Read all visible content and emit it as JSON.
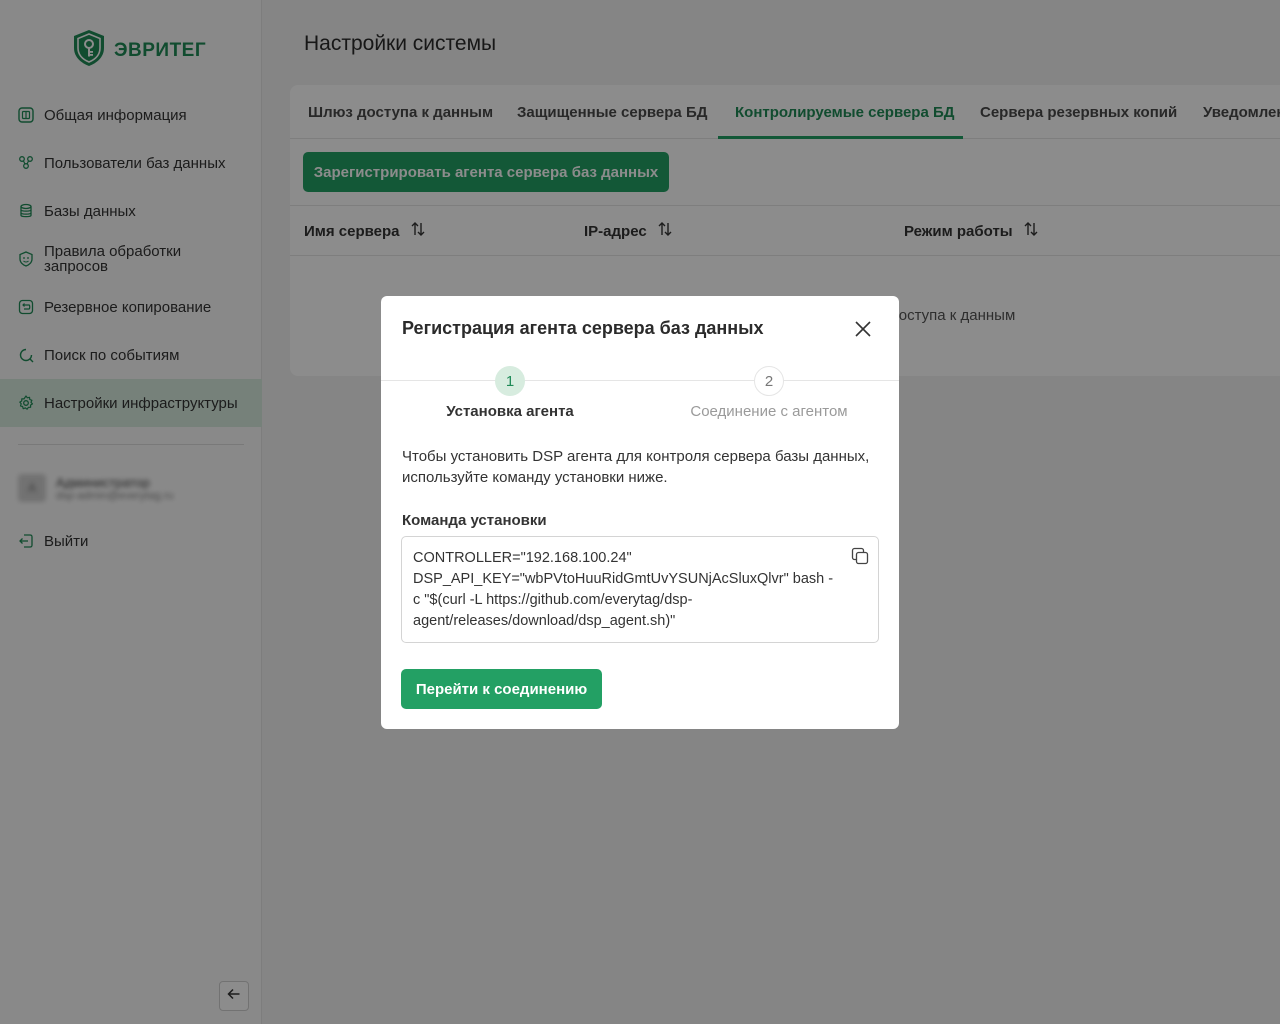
{
  "brand": {
    "name": "ЭВРИТЕГ",
    "color": "#1f8a57"
  },
  "sidebar": {
    "items": [
      {
        "label": "Общая информация",
        "icon": "dashboard-icon"
      },
      {
        "label": "Пользователи баз данных",
        "icon": "users-icon"
      },
      {
        "label": "Базы данных",
        "icon": "database-icon"
      },
      {
        "label": "Правила обработки запросов",
        "icon": "shield-icon"
      },
      {
        "label": "Резервное копирование",
        "icon": "backup-icon"
      },
      {
        "label": "Поиск по событиям",
        "icon": "search-icon"
      },
      {
        "label": "Настройки инфраструктуры",
        "icon": "gear-icon"
      }
    ],
    "active_index": 6,
    "user": {
      "initials": "А",
      "name": "Администратор",
      "email": "dsp-admin@everytag.ru"
    },
    "logout_label": "Выйти"
  },
  "main": {
    "title": "Настройки системы",
    "tabs": [
      {
        "label": "Шлюз доступа к данным"
      },
      {
        "label": "Защищенные сервера БД"
      },
      {
        "label": "Контролируемые сервера БД"
      },
      {
        "label": "Сервера резервных копий"
      },
      {
        "label": "Уведомлен"
      }
    ],
    "active_tab": 2,
    "register_button": "Зарегистрировать агента сервера баз данных",
    "columns": [
      "Имя сервера",
      "IP-адрес",
      "Режим работы"
    ],
    "empty_text": "доступа к данным"
  },
  "modal": {
    "title": "Регистрация агента сервера баз данных",
    "steps": [
      {
        "number": "1",
        "label": "Установка агента"
      },
      {
        "number": "2",
        "label": "Соединение с агентом"
      }
    ],
    "active_step": 0,
    "description": "Чтобы установить DSP агента для контроля сервера базы данных, используйте команду установки ниже.",
    "command_label": "Команда установки",
    "command": "CONTROLLER=\"192.168.100.24\" DSP_API_KEY=\"wbPVtoHuuRidGmtUvYSUNjAcSluxQlvr\" bash -c \"$(curl -L https://github.com/everytag/dsp-agent/releases/download/dsp_agent.sh)\"",
    "next_button": "Перейти к соединению"
  },
  "colors": {
    "accent": "#23a064",
    "active_bg": "#d7ecdf"
  }
}
